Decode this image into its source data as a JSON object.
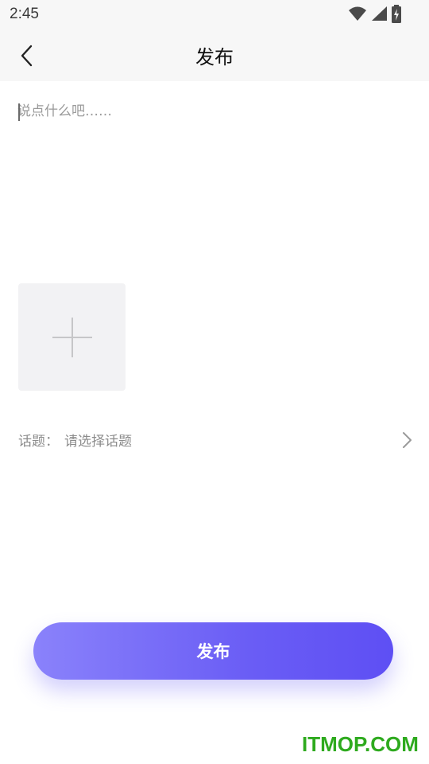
{
  "status_bar": {
    "time": "2:45",
    "icons": [
      "wifi-icon",
      "cellular-signal-icon",
      "battery-charging-icon"
    ]
  },
  "header": {
    "title": "发布",
    "back_icon": "chevron-left-icon"
  },
  "post": {
    "content_value": "",
    "content_placeholder": "说点什么吧……",
    "add_image_icon": "plus-icon"
  },
  "topic": {
    "label": "话题：",
    "placeholder": "请选择话题",
    "chevron_icon": "chevron-right-icon"
  },
  "actions": {
    "publish_label": "发布"
  },
  "watermark": {
    "text": "ITMOP.COM"
  },
  "colors": {
    "accent_start": "#8a82fb",
    "accent_end": "#5e4ff4",
    "placeholder": "#9a9a9a",
    "tile_bg": "#f2f2f4",
    "watermark": "#2eaa1e"
  }
}
